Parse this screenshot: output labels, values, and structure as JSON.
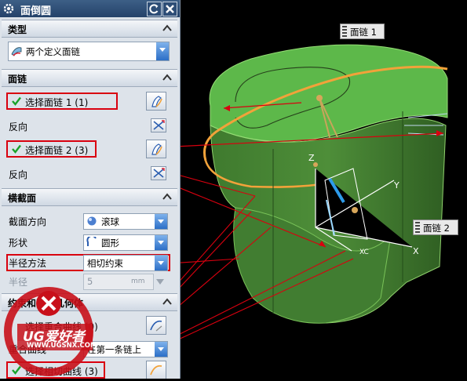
{
  "dialog": {
    "title": "面倒圆",
    "sections": {
      "type": {
        "header": "类型",
        "selected": "两个定义面链"
      },
      "face_chains": {
        "header": "面链",
        "chain1_label": "选择面链 1 (1)",
        "chain2_label": "选择面链 2 (3)",
        "reverse1": "反向",
        "reverse2": "反向"
      },
      "cross_section": {
        "header": "横截面",
        "section_dir_label": "截面方向",
        "section_dir_value": "滚球",
        "shape_label": "形状",
        "shape_value": "圆形",
        "radius_method_label": "半径方法",
        "radius_method_value": "相切约束",
        "radius_label": "半径",
        "radius_value": "5",
        "radius_unit": "mm"
      },
      "constraints": {
        "header": "约束和限制几何体",
        "select_overlap": "选择重合曲线 (0)",
        "overlap_label": "重合曲线",
        "overlap_value": "在第一条链上",
        "select_tangent": "选择相切曲线 (3)"
      }
    }
  },
  "viewport": {
    "tag1": "面链 1",
    "tag2": "面链 2",
    "axis_labels": {
      "x": "X",
      "y": "Y",
      "z": "Z",
      "xc": "XC"
    }
  },
  "watermark": {
    "brand": "UG爱好者",
    "url": "WWW.UGSNX.COM"
  },
  "colors": {
    "annotation_red": "#d9000f",
    "face_green": "#5db84a",
    "highlight_orange": "#f2a23a",
    "combo_blue": "#2c6fc7"
  }
}
